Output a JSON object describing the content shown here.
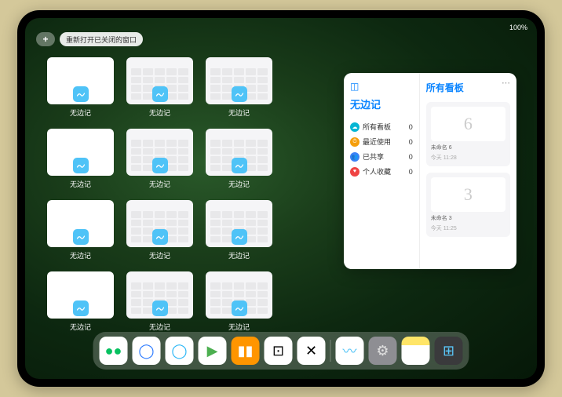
{
  "status": {
    "time": "",
    "battery": "100%"
  },
  "top": {
    "add": "+",
    "reopen": "重新打开已关闭的窗口"
  },
  "thumb_label": "无边记",
  "thumbs": [
    {
      "variant": "blank"
    },
    {
      "variant": "calendar"
    },
    {
      "variant": "calendar"
    },
    {
      "variant": "blank"
    },
    {
      "variant": "calendar"
    },
    {
      "variant": "calendar"
    },
    {
      "variant": "blank"
    },
    {
      "variant": "calendar"
    },
    {
      "variant": "calendar"
    },
    {
      "variant": "blank"
    },
    {
      "variant": "calendar"
    },
    {
      "variant": "calendar"
    }
  ],
  "panel": {
    "title": "无边记",
    "right_title": "所有看板",
    "items": [
      {
        "color": "cyan",
        "glyph": "☁",
        "label": "所有看板",
        "count": "0"
      },
      {
        "color": "orange",
        "glyph": "⏱",
        "label": "最近使用",
        "count": "0"
      },
      {
        "color": "blue",
        "glyph": "👥",
        "label": "已共享",
        "count": "0"
      },
      {
        "color": "red",
        "glyph": "♥",
        "label": "个人收藏",
        "count": "0"
      }
    ],
    "boards": [
      {
        "glyph": "6",
        "name": "未命名 6",
        "sub": "今天 11:28"
      },
      {
        "glyph": "3",
        "name": "未命名 3",
        "sub": "今天 11:25"
      }
    ]
  },
  "dock": [
    {
      "name": "wechat",
      "bg": "#fff",
      "glyph": "●●",
      "color": "#07c160"
    },
    {
      "name": "quark",
      "bg": "#fff",
      "glyph": "◯",
      "color": "#2979ff"
    },
    {
      "name": "qqbrowser",
      "bg": "#fff",
      "glyph": "◯",
      "color": "#29b6f6"
    },
    {
      "name": "play",
      "bg": "#fff",
      "glyph": "▶",
      "color": "#4caf50"
    },
    {
      "name": "books",
      "bg": "#ff9500",
      "glyph": "▮▮",
      "color": "#fff"
    },
    {
      "name": "dice",
      "bg": "#fff",
      "glyph": "⊡",
      "color": "#000"
    },
    {
      "name": "share",
      "bg": "#fff",
      "glyph": "✕",
      "color": "#000"
    },
    {
      "sep": true
    },
    {
      "name": "freeform",
      "bg": "#fff",
      "glyph": "〰",
      "color": "#4fc3f7"
    },
    {
      "name": "settings",
      "bg": "#8e8e93",
      "glyph": "⚙",
      "color": "#e0e0e0"
    },
    {
      "name": "notes",
      "bg": "linear-gradient(#ffe568 30%,#fff 30%)",
      "glyph": "",
      "color": "#000"
    },
    {
      "name": "multitask",
      "bg": "#3a3a3c",
      "glyph": "⊞",
      "color": "#5ac8fa"
    }
  ]
}
